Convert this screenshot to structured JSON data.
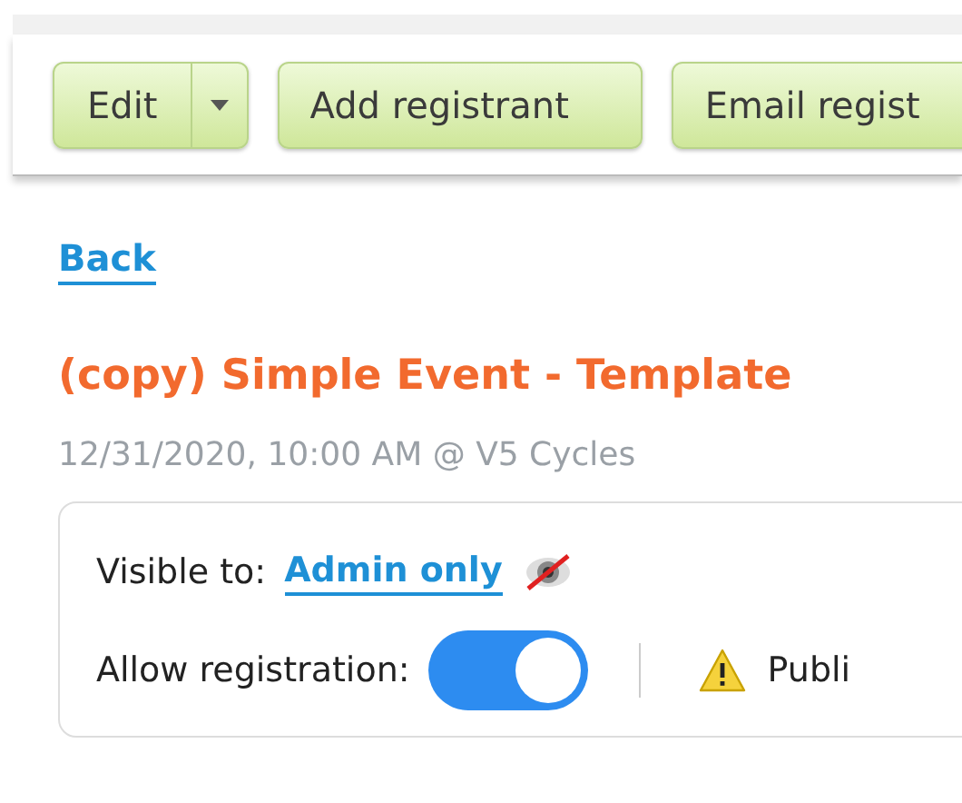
{
  "toolbar": {
    "buttons": [
      {
        "label": "Edit",
        "kind": "split"
      },
      {
        "label": "Add registrant",
        "kind": "plain"
      },
      {
        "label": "Email regist",
        "kind": "plain"
      }
    ]
  },
  "back_link": "Back",
  "event": {
    "title": "(copy) Simple Event - Template",
    "when": "12/31/2020, 10:00 AM @ V5 Cycles"
  },
  "settings": {
    "visible_label": "Visible to:",
    "visible_value": "Admin only",
    "hidden": true,
    "registration_label": "Allow registration:",
    "registration_on": true,
    "publish_warning": "Publi"
  }
}
